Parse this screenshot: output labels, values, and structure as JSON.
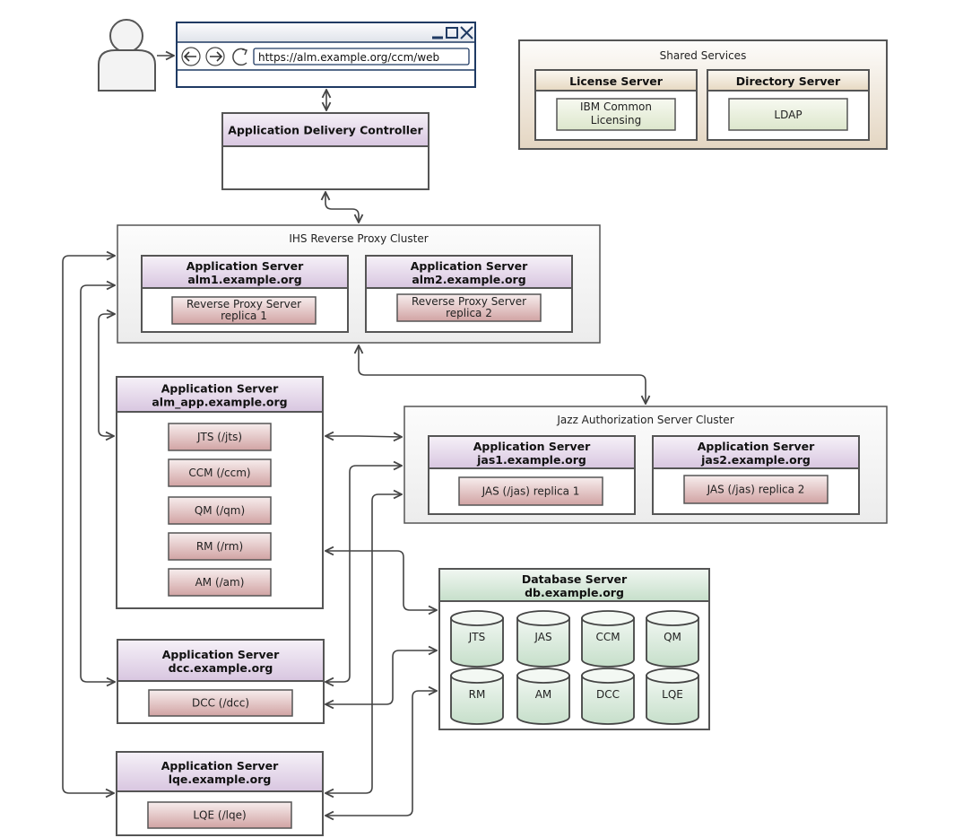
{
  "user": {
    "icon": "user-icon"
  },
  "browser": {
    "url": "https://alm.example.org/ccm/web",
    "icons": [
      "minimize-icon",
      "maximize-icon",
      "close-icon",
      "back-icon",
      "forward-icon",
      "reload-icon"
    ]
  },
  "adc": {
    "title": "Application Delivery Controller"
  },
  "shared_services": {
    "title": "Shared Services",
    "license_server": {
      "title": "License Server",
      "component": [
        "IBM Common",
        "Licensing"
      ]
    },
    "directory_server": {
      "title": "Directory Server",
      "component": "LDAP"
    }
  },
  "ihs_cluster": {
    "title": "IHS Reverse Proxy Cluster",
    "servers": [
      {
        "title": "Application Server",
        "host": "alm1.example.org",
        "component": [
          "Reverse Proxy Server",
          "replica 1"
        ]
      },
      {
        "title": "Application Server",
        "host": "alm2.example.org",
        "component": [
          "Reverse Proxy Server",
          "replica 2"
        ]
      }
    ]
  },
  "alm_app": {
    "title": "Application Server",
    "host": "alm_app.example.org",
    "components": [
      "JTS (/jts)",
      "CCM (/ccm)",
      "QM (/qm)",
      "RM (/rm)",
      "AM (/am)"
    ]
  },
  "jas_cluster": {
    "title": "Jazz Authorization Server Cluster",
    "servers": [
      {
        "title": "Application Server",
        "host": "jas1.example.org",
        "component": "JAS (/jas) replica 1"
      },
      {
        "title": "Application Server",
        "host": "jas2.example.org",
        "component": "JAS (/jas) replica 2"
      }
    ]
  },
  "db": {
    "title": "Database Server",
    "host": "db.example.org",
    "databases": [
      "JTS",
      "JAS",
      "CCM",
      "QM",
      "RM",
      "AM",
      "DCC",
      "LQE"
    ]
  },
  "dcc": {
    "title": "Application Server",
    "host": "dcc.example.org",
    "components": [
      "DCC (/dcc)"
    ]
  },
  "lqe": {
    "title": "Application Server",
    "host": "lqe.example.org",
    "components": [
      "LQE (/lqe)"
    ]
  },
  "colors": {
    "line": "#444444",
    "browser_frame": "#1f3a63",
    "app_header": "#dccbe3",
    "component": "#d4a8a8",
    "database": "#c8e0cc",
    "shared_bg": "#e8dcc5"
  }
}
